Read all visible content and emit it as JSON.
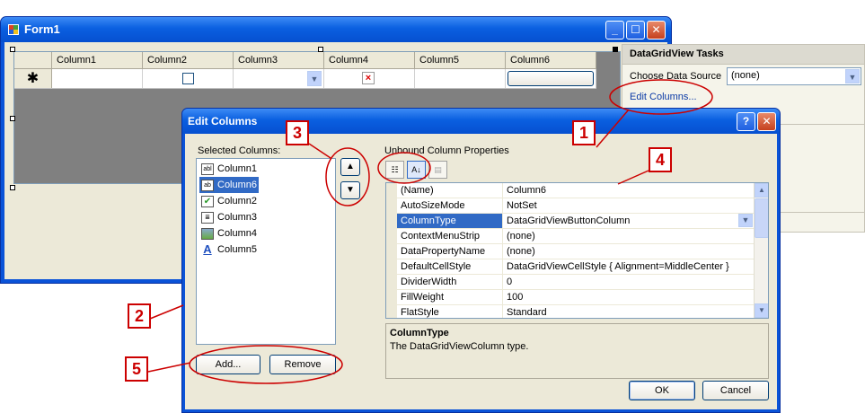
{
  "form1": {
    "title": "Form1",
    "columns": [
      "Column1",
      "Column2",
      "Column3",
      "Column4",
      "Column5",
      "Column6"
    ],
    "new_row_marker": "✱"
  },
  "tasks": {
    "title": "DataGridView Tasks",
    "choose_label": "Choose Data Source",
    "choose_value": "(none)",
    "edit_link": "Edit Columns..."
  },
  "dialog": {
    "title": "Edit Columns",
    "selected_label": "Selected Columns:",
    "unbound_label": "Unbound Column Properties",
    "selected_columns": [
      {
        "label": "Column1",
        "icon": "textbox-column-icon"
      },
      {
        "label": "Column6",
        "icon": "button-column-icon"
      },
      {
        "label": "Column2",
        "icon": "checkbox-column-icon"
      },
      {
        "label": "Column3",
        "icon": "combobox-column-icon"
      },
      {
        "label": "Column4",
        "icon": "image-column-icon"
      },
      {
        "label": "Column5",
        "icon": "link-column-icon"
      }
    ],
    "properties": [
      {
        "name": "(Name)",
        "value": "Column6"
      },
      {
        "name": "AutoSizeMode",
        "value": "NotSet"
      },
      {
        "name": "ColumnType",
        "value": "DataGridViewButtonColumn"
      },
      {
        "name": "ContextMenuStrip",
        "value": "(none)"
      },
      {
        "name": "DataPropertyName",
        "value": "(none)"
      },
      {
        "name": "DefaultCellStyle",
        "value": "DataGridViewCellStyle { Alignment=MiddleCenter }"
      },
      {
        "name": "DividerWidth",
        "value": "0"
      },
      {
        "name": "FillWeight",
        "value": "100"
      },
      {
        "name": "FlatStyle",
        "value": "Standard"
      }
    ],
    "desc_title": "ColumnType",
    "desc_text": "The DataGridViewColumn type.",
    "add_label": "Add...",
    "remove_label": "Remove",
    "ok_label": "OK",
    "cancel_label": "Cancel"
  },
  "callouts": [
    "1",
    "2",
    "3",
    "4",
    "5"
  ],
  "colors": {
    "title_blue": "#0a5fe0",
    "selection_blue": "#316ac5",
    "annotation_red": "#cc0000",
    "link_blue": "#0b3aa6"
  }
}
